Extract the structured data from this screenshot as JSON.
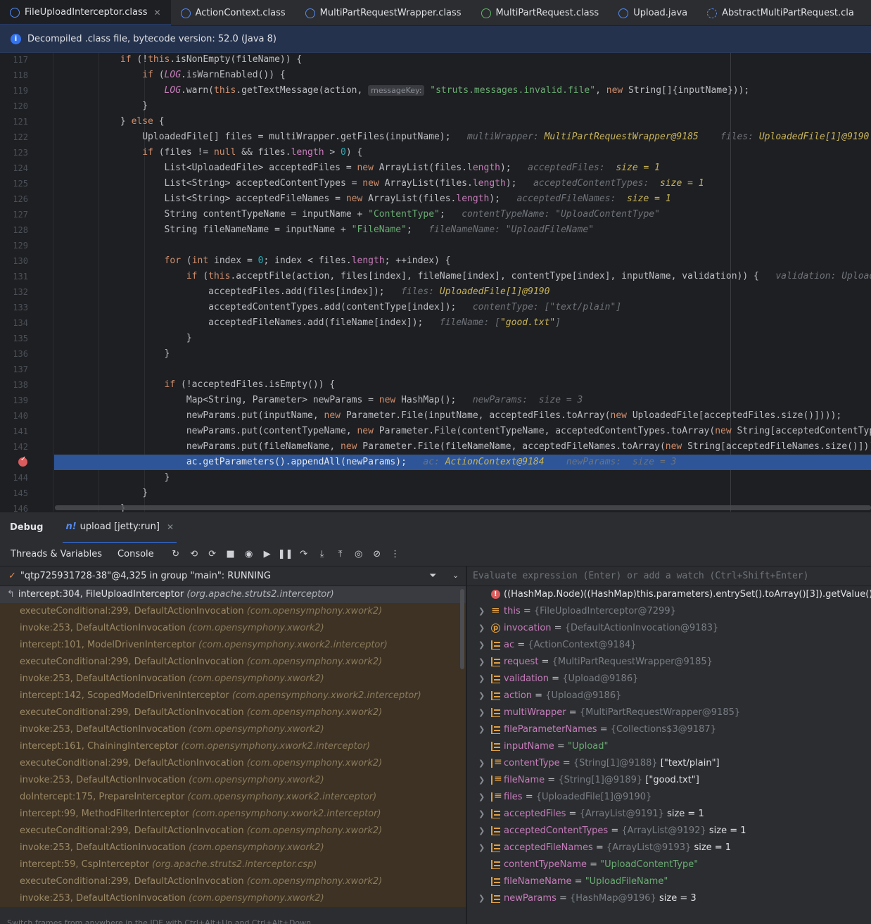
{
  "tabs": [
    {
      "label": "FileUploadInterceptor.class",
      "icon": "class-icon",
      "active": true,
      "closable": true
    },
    {
      "label": "ActionContext.class",
      "icon": "class-icon"
    },
    {
      "label": "MultiPartRequestWrapper.class",
      "icon": "class-icon"
    },
    {
      "label": "MultiPartRequest.class",
      "icon": "interface-icon"
    },
    {
      "label": "Upload.java",
      "icon": "class-icon"
    },
    {
      "label": "AbstractMultiPartRequest.cla",
      "icon": "abstract-class-icon"
    }
  ],
  "banner": {
    "text": "Decompiled .class file, bytecode version: 52.0 (Java 8)"
  },
  "editor": {
    "line_numbers": [
      "117",
      "118",
      "119",
      "120",
      "121",
      "122",
      "123",
      "124",
      "125",
      "126",
      "127",
      "128",
      "129",
      "130",
      "131",
      "132",
      "133",
      "134",
      "135",
      "136",
      "137",
      "138",
      "139",
      "140",
      "141",
      "142",
      "",
      "144",
      "145",
      "146"
    ],
    "breakpoint_line": "143"
  },
  "debug": {
    "title": "Debug",
    "session": "upload [jetty:run]",
    "tabs": {
      "threads": "Threads & Variables",
      "console": "Console"
    },
    "thread": "\"qtp725931728-38\"@4,325 in group \"main\": RUNNING",
    "eval_placeholder": "Evaluate expression (Enter) or add a watch (Ctrl+Shift+Enter)",
    "frames_hint": "Switch frames from anywhere in the IDE with Ctrl+Alt+Up and Ctrl+Alt+Down",
    "frames": [
      {
        "loc": "intercept:304, FileUploadInterceptor",
        "pkg": "(org.apache.struts2.interceptor)"
      },
      {
        "loc": "executeConditional:299, DefaultActionInvocation",
        "pkg": "(com.opensymphony.xwork2)"
      },
      {
        "loc": "invoke:253, DefaultActionInvocation",
        "pkg": "(com.opensymphony.xwork2)"
      },
      {
        "loc": "intercept:101, ModelDrivenInterceptor",
        "pkg": "(com.opensymphony.xwork2.interceptor)"
      },
      {
        "loc": "executeConditional:299, DefaultActionInvocation",
        "pkg": "(com.opensymphony.xwork2)"
      },
      {
        "loc": "invoke:253, DefaultActionInvocation",
        "pkg": "(com.opensymphony.xwork2)"
      },
      {
        "loc": "intercept:142, ScopedModelDrivenInterceptor",
        "pkg": "(com.opensymphony.xwork2.interceptor)"
      },
      {
        "loc": "executeConditional:299, DefaultActionInvocation",
        "pkg": "(com.opensymphony.xwork2)"
      },
      {
        "loc": "invoke:253, DefaultActionInvocation",
        "pkg": "(com.opensymphony.xwork2)"
      },
      {
        "loc": "intercept:161, ChainingInterceptor",
        "pkg": "(com.opensymphony.xwork2.interceptor)"
      },
      {
        "loc": "executeConditional:299, DefaultActionInvocation",
        "pkg": "(com.opensymphony.xwork2)"
      },
      {
        "loc": "invoke:253, DefaultActionInvocation",
        "pkg": "(com.opensymphony.xwork2)"
      },
      {
        "loc": "doIntercept:175, PrepareInterceptor",
        "pkg": "(com.opensymphony.xwork2.interceptor)"
      },
      {
        "loc": "intercept:99, MethodFilterInterceptor",
        "pkg": "(com.opensymphony.xwork2.interceptor)"
      },
      {
        "loc": "executeConditional:299, DefaultActionInvocation",
        "pkg": "(com.opensymphony.xwork2)"
      },
      {
        "loc": "invoke:253, DefaultActionInvocation",
        "pkg": "(com.opensymphony.xwork2)"
      },
      {
        "loc": "intercept:59, CspInterceptor",
        "pkg": "(org.apache.struts2.interceptor.csp)"
      },
      {
        "loc": "executeConditional:299, DefaultActionInvocation",
        "pkg": "(com.opensymphony.xwork2)"
      },
      {
        "loc": "invoke:253, DefaultActionInvocation",
        "pkg": "(com.opensymphony.xwork2)"
      }
    ],
    "variables": [
      {
        "kind": "err",
        "expandable": false,
        "name": "((HashMap.Node)((HashMap)this.parameters).entrySet().toArray()[3]).getValue() =",
        "ref": "",
        "value": ""
      },
      {
        "kind": "thisic",
        "expandable": true,
        "name": "this",
        "ref": "{FileUploadInterceptor@7299}",
        "value": ""
      },
      {
        "kind": "param",
        "expandable": true,
        "name": "invocation",
        "ref": "{DefaultActionInvocation@9183}",
        "value": ""
      },
      {
        "kind": "field",
        "expandable": true,
        "name": "ac",
        "ref": "{ActionContext@9184}",
        "value": ""
      },
      {
        "kind": "field",
        "expandable": true,
        "name": "request",
        "ref": "{MultiPartRequestWrapper@9185}",
        "value": ""
      },
      {
        "kind": "field",
        "expandable": true,
        "name": "validation",
        "ref": "{Upload@9186}",
        "value": ""
      },
      {
        "kind": "field",
        "expandable": true,
        "name": "action",
        "ref": "{Upload@9186}",
        "value": ""
      },
      {
        "kind": "field",
        "expandable": true,
        "name": "multiWrapper",
        "ref": "{MultiPartRequestWrapper@9185}",
        "value": ""
      },
      {
        "kind": "field",
        "expandable": true,
        "name": "fileParameterNames",
        "ref": "{Collections$3@9187}",
        "value": ""
      },
      {
        "kind": "field",
        "expandable": false,
        "name": "inputName",
        "ref": "",
        "value": "\"Upload\"",
        "str": true
      },
      {
        "kind": "arr",
        "expandable": true,
        "name": "contentType",
        "ref": "{String[1]@9188}",
        "value": "[\"text/plain\"]"
      },
      {
        "kind": "arr",
        "expandable": true,
        "name": "fileName",
        "ref": "{String[1]@9189}",
        "value": "[\"good.txt\"]"
      },
      {
        "kind": "arr",
        "expandable": true,
        "name": "files",
        "ref": "{UploadedFile[1]@9190}",
        "value": ""
      },
      {
        "kind": "field",
        "expandable": true,
        "name": "acceptedFiles",
        "ref": "{ArrayList@9191}",
        "value": "size = 1"
      },
      {
        "kind": "field",
        "expandable": true,
        "name": "acceptedContentTypes",
        "ref": "{ArrayList@9192}",
        "value": "size = 1"
      },
      {
        "kind": "field",
        "expandable": true,
        "name": "acceptedFileNames",
        "ref": "{ArrayList@9193}",
        "value": "size = 1"
      },
      {
        "kind": "field",
        "expandable": false,
        "name": "contentTypeName",
        "ref": "",
        "value": "\"UploadContentType\"",
        "str": true
      },
      {
        "kind": "field",
        "expandable": false,
        "name": "fileNameName",
        "ref": "",
        "value": "\"UploadFileName\"",
        "str": true
      },
      {
        "kind": "field",
        "expandable": true,
        "name": "newParams",
        "ref": "{HashMap@9196}",
        "value": "size = 3"
      }
    ]
  },
  "colors": {
    "accent": "#3574f0",
    "exec_line": "#2d5597",
    "breakpoint": "#db5c5c",
    "keyword": "#cf8e6d",
    "string": "#6aab73",
    "field": "#c77dbb"
  }
}
